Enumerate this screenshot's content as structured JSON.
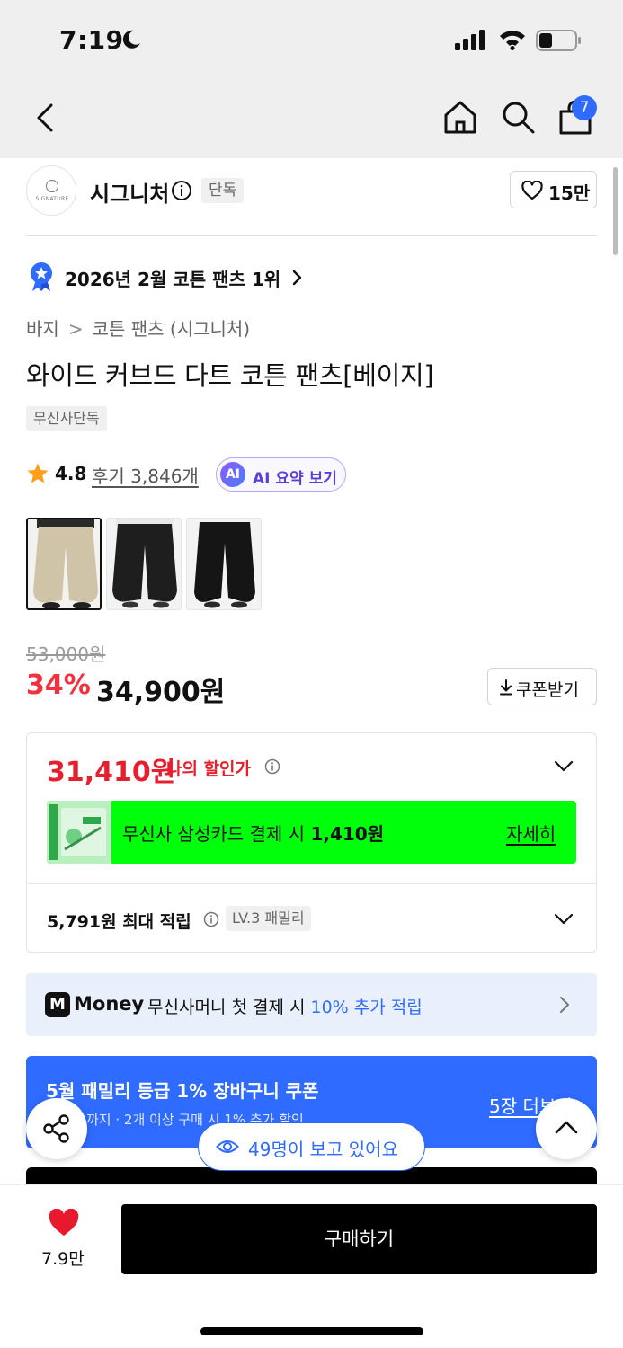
{
  "status": {
    "time": "7:19"
  },
  "nav": {
    "cart_count": "7"
  },
  "brand": {
    "name": "시그니처",
    "logo_text": "SIGNATURE",
    "tag": "단독",
    "likes": "15만"
  },
  "ranking": {
    "text": "2026년 2월 코튼 팬츠 1위"
  },
  "breadcrumb": [
    "바지",
    "코튼 팬츠 (시그니처)"
  ],
  "product": {
    "title": "와이드 커브드 다트 코튼 팬츠[베이지]",
    "exclusive_tag": "무신사단독",
    "rating": "4.8",
    "reviews": "후기 3,846개",
    "ai_badge": "AI",
    "ai_summary": "AI 요약 보기",
    "thumbnails": [
      {
        "name": "베이지",
        "color": "#cfc3a8"
      },
      {
        "name": "블랙 1",
        "color": "#1e1e1e"
      },
      {
        "name": "블랙 2",
        "color": "#151515"
      }
    ]
  },
  "price": {
    "original": "53,000원",
    "discount": "34%",
    "current": "34,900원",
    "coupon_button": "쿠폰받기"
  },
  "benefits": {
    "my_price": "31,410원",
    "my_price_label": "나의 할인가",
    "card_promo_text": "무신사 삼성카드 결제 시 ",
    "card_promo_amount": "1,410원",
    "card_promo_link": "자세히",
    "points": "5,791원 최대 적립",
    "level_tag": "LV.3 패밀리"
  },
  "money": {
    "logo": "M",
    "brand": "Money",
    "text": "무신사머니 첫 결제 시 ",
    "highlight": "10% 추가 적립"
  },
  "coupon_banner": {
    "title": "5월 패밀리 등급 1% 장바구니 쿠폰",
    "subtitle": "까지 · 2개 이상 구매 시 1% 추가 할인",
    "link": "5장 더보기"
  },
  "floating": {
    "viewers": "49명이 보고 있어요"
  },
  "bottom": {
    "like_count": "7.9만",
    "buy_label": "구매하기"
  },
  "colors": {
    "accent_blue": "#2f6bff",
    "sale_red": "#f2303e",
    "promo_green": "#00ff0a"
  }
}
